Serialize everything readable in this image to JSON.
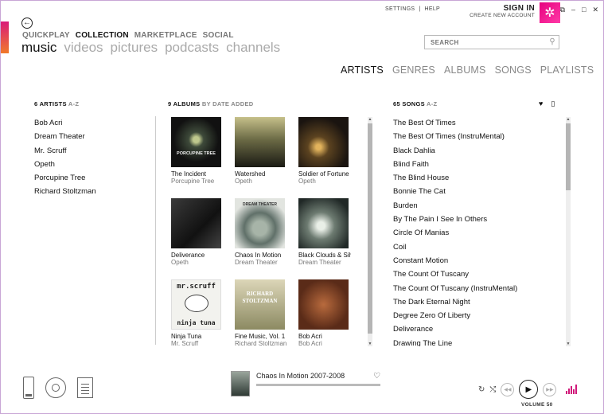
{
  "window": {
    "top_links": [
      "SETTINGS",
      "|",
      "HELP"
    ],
    "sign_in": "SIGN IN",
    "create_account": "CREATE NEW ACCOUNT",
    "controls": [
      "⧉",
      "–",
      "□",
      "✕"
    ]
  },
  "nav": {
    "top": [
      "QUICKPLAY",
      "COLLECTION",
      "MARKETPLACE",
      "SOCIAL"
    ],
    "top_active": "COLLECTION",
    "sub": [
      "music",
      "videos",
      "pictures",
      "podcasts",
      "channels"
    ],
    "sub_active": "music"
  },
  "search": {
    "placeholder": "SEARCH"
  },
  "views": {
    "items": [
      "ARTISTS",
      "GENRES",
      "ALBUMS",
      "SONGS",
      "PLAYLISTS"
    ],
    "active": "ARTISTS"
  },
  "artists": {
    "count_label": "6 ARTISTS",
    "sort_label": "A-Z",
    "items": [
      "Bob Acri",
      "Dream Theater",
      "Mr. Scruff",
      "Opeth",
      "Porcupine Tree",
      "Richard Stoltzman"
    ]
  },
  "albums": {
    "count_label": "9 ALBUMS",
    "sort_label": "BY DATE ADDED",
    "items": [
      {
        "name": "The Incident",
        "artist": "Porcupine Tree",
        "cover": "c1"
      },
      {
        "name": "Watershed",
        "artist": "Opeth",
        "cover": "c2"
      },
      {
        "name": "Soldier of Fortune",
        "artist": "Opeth",
        "cover": "c3"
      },
      {
        "name": "Deliverance",
        "artist": "Opeth",
        "cover": "c4"
      },
      {
        "name": "Chaos In Motion",
        "artist": "Dream Theater",
        "cover": "c5"
      },
      {
        "name": "Black Clouds & Silver",
        "artist": "Dream Theater",
        "cover": "c6"
      },
      {
        "name": "Ninja Tuna",
        "artist": "Mr. Scruff",
        "cover": "c7"
      },
      {
        "name": "Fine Music, Vol. 1",
        "artist": "Richard Stoltzman",
        "cover": "c8"
      },
      {
        "name": "Bob Acri",
        "artist": "Bob Acri",
        "cover": "c9"
      }
    ],
    "cover_text": {
      "c1": "PORCUPINE TREE",
      "c5": "DREAM THEATER",
      "c7_top": "mr.scruff",
      "c7_bottom": "ninja tuna",
      "c8": "RICHARD STOLTZMAN"
    }
  },
  "songs": {
    "count_label": "65 SONGS",
    "sort_label": "A-Z",
    "icons": [
      "heart-icon",
      "device-icon"
    ],
    "items": [
      "The Best Of Times",
      "The Best Of Times (InstruMental)",
      "Black Dahlia",
      "Blind Faith",
      "The Blind House",
      "Bonnie The Cat",
      "Burden",
      "By The Pain I See In Others",
      "Circle Of Manias",
      "Coil",
      "Constant Motion",
      "The Count Of Tuscany",
      "The Count Of Tuscany (InstruMental)",
      "The Dark Eternal Night",
      "Degree Zero Of Liberty",
      "Deliverance",
      "Drawing The Line"
    ]
  },
  "now_playing": {
    "title": "Chaos In Motion 2007-2008",
    "progress": 0.0
  },
  "transport": {
    "volume_label": "VOLUME 50"
  },
  "colors": {
    "accent": "#e6007e",
    "text": "#111111",
    "dim": "#888888"
  }
}
